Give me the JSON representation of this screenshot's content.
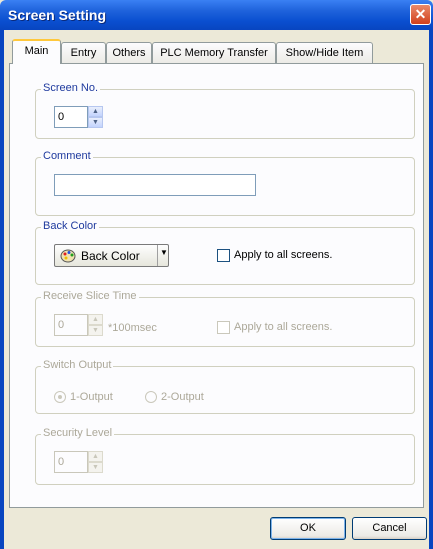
{
  "window": {
    "title": "Screen Setting",
    "close_glyph": "✕"
  },
  "tabs": [
    "Main",
    "Entry",
    "Others",
    "PLC Memory Transfer",
    "Show/Hide Item"
  ],
  "active_tab": "Main",
  "screen_no": {
    "title": "Screen No.",
    "value": "0"
  },
  "comment": {
    "title": "Comment",
    "value": ""
  },
  "back_color": {
    "title": "Back Color",
    "button_label": "Back Color",
    "button_icon": "palette-icon",
    "apply_all_label": "Apply to all screens.",
    "apply_all_checked": false
  },
  "receive_slice": {
    "title": "Receive Slice Time",
    "value": "0",
    "unit": "*100msec",
    "apply_all_label": "Apply to all screens.",
    "apply_all_checked": false,
    "enabled": false
  },
  "switch_output": {
    "title": "Switch Output",
    "options": [
      "1-Output",
      "2-Output"
    ],
    "selected": "1-Output",
    "enabled": false
  },
  "security_level": {
    "title": "Security Level",
    "value": "0",
    "enabled": false
  },
  "footer": {
    "ok_label": "OK",
    "cancel_label": "Cancel"
  },
  "colors": {
    "title_bar": "#0a4fd0",
    "dialog_bg": "#ece9d8",
    "panel_bg": "#fcfcfe",
    "group_title": "#1f3a9e",
    "disabled_text": "#aca899"
  }
}
